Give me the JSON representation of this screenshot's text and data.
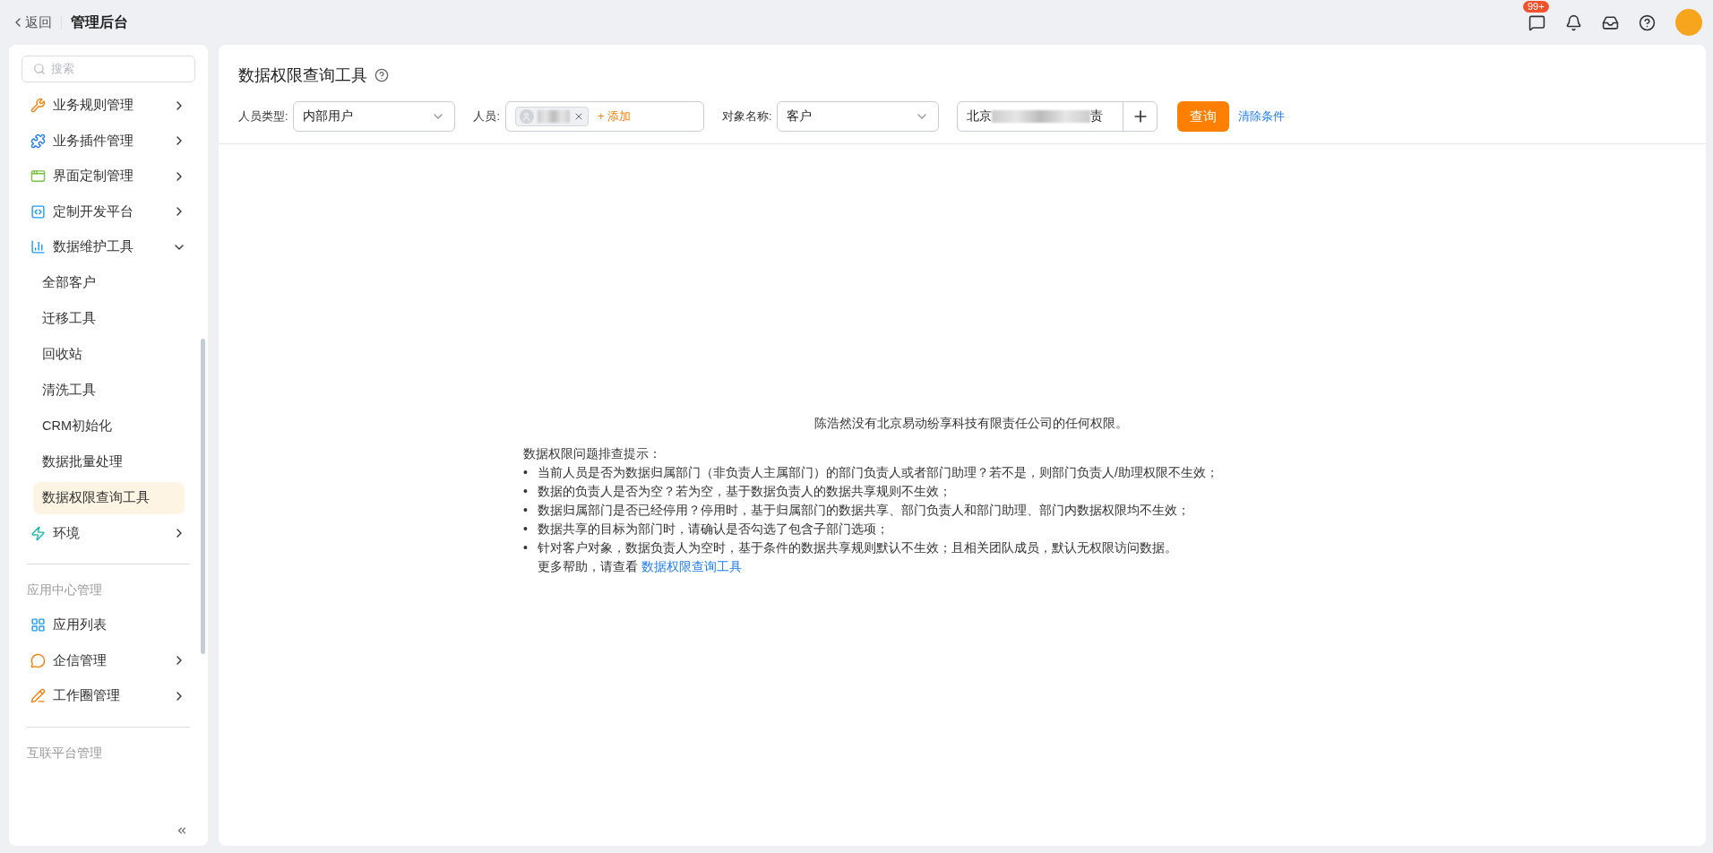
{
  "topbar": {
    "back": "返回",
    "title": "管理后台",
    "badge": "99+"
  },
  "sidebar": {
    "search": {
      "placeholder": "搜索"
    },
    "sections": [
      {
        "items": [
          {
            "label": "业务规则管理",
            "expanded": false
          },
          {
            "label": "业务插件管理",
            "expanded": false
          },
          {
            "label": "界面定制管理",
            "expanded": false
          },
          {
            "label": "定制开发平台",
            "expanded": false
          },
          {
            "label": "数据维护工具",
            "expanded": true,
            "children": [
              {
                "label": "全部客户",
                "selected": false
              },
              {
                "label": "迁移工具",
                "selected": false
              },
              {
                "label": "回收站",
                "selected": false
              },
              {
                "label": "清洗工具",
                "selected": false
              },
              {
                "label": "CRM初始化",
                "selected": false
              },
              {
                "label": "数据批量处理",
                "selected": false
              },
              {
                "label": "数据权限查询工具",
                "selected": true
              }
            ]
          },
          {
            "label": "环境",
            "expanded": false
          }
        ]
      },
      {
        "title": "应用中心管理",
        "items": [
          {
            "label": "应用列表"
          },
          {
            "label": "企信管理",
            "expanded": false
          },
          {
            "label": "工作圈管理",
            "expanded": false
          }
        ]
      },
      {
        "title": "互联平台管理"
      }
    ]
  },
  "page": {
    "title": "数据权限查询工具",
    "filters": [
      {
        "kind": "select",
        "label": "人员类型:",
        "value": "内部用户"
      },
      {
        "kind": "people",
        "label": "人员:",
        "add": "+ 添加"
      },
      {
        "kind": "select",
        "label": "对象名称:",
        "value": "客户"
      },
      {
        "kind": "lookup",
        "value_start": "北京",
        "value_end": "责"
      }
    ],
    "query_button": "查询",
    "clear_link": "清除条件",
    "message": "陈浩然没有北京易动纷享科技有限责任公司的任何权限。",
    "tips_title": "数据权限问题排查提示：",
    "bullet": "•",
    "tips": [
      "当前人员是否为数据归属部门（非负责人主属部门）的部门负责人或者部门助理？若不是，则部门负责人/助理权限不生效；",
      "数据的负责人是否为空？若为空，基于数据负责人的数据共享规则不生效；",
      "数据归属部门是否已经停用？停用时，基于归属部门的数据共享、部门负责人和部门助理、部门内数据权限均不生效；",
      "数据共享的目标为部门时，请确认是否勾选了包含子部门选项；",
      "针对客户对象，数据负责人为空时，基于条件的数据共享规则默认不生效；且相关团队成员，默认无权限访问数据。"
    ],
    "help_text": "更多帮助，请查看",
    "help_link": "数据权限查询工具"
  }
}
